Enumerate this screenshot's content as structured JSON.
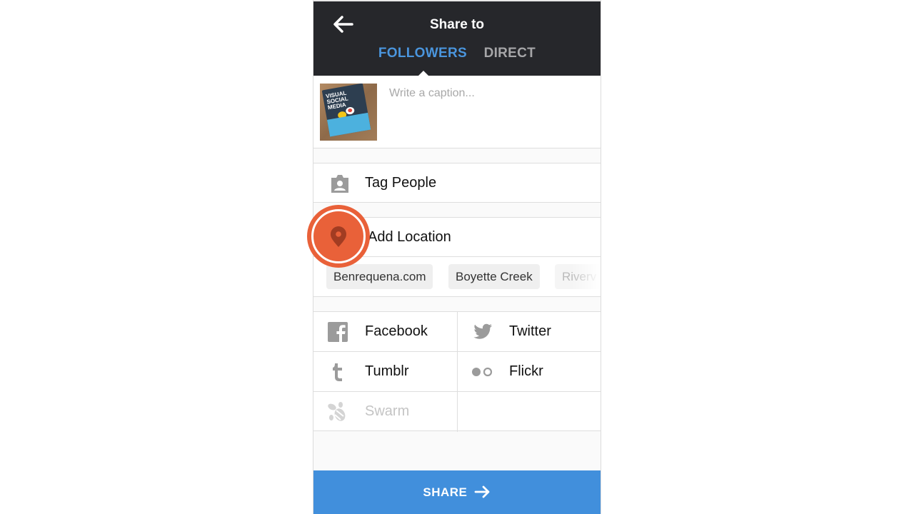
{
  "header": {
    "title": "Share to",
    "back_icon": "arrow-left-icon",
    "tabs": [
      {
        "label": "FOLLOWERS",
        "active": true
      },
      {
        "label": "DIRECT",
        "active": false
      }
    ]
  },
  "caption": {
    "placeholder": "Write a caption...",
    "value": "",
    "thumbnail_text": "VISUAL SOCIAL MEDIA"
  },
  "options": {
    "tag_people": {
      "label": "Tag People",
      "icon": "tag-person-icon"
    },
    "add_location": {
      "label": "Add Location",
      "icon": "location-pin-icon"
    }
  },
  "location_suggestions": [
    {
      "label": "Benrequena.com"
    },
    {
      "label": "Boyette Creek"
    },
    {
      "label": "Riverv"
    }
  ],
  "social": [
    {
      "label": "Facebook",
      "icon": "facebook-icon",
      "enabled": true
    },
    {
      "label": "Twitter",
      "icon": "twitter-icon",
      "enabled": true
    },
    {
      "label": "Tumblr",
      "icon": "tumblr-icon",
      "enabled": true
    },
    {
      "label": "Flickr",
      "icon": "flickr-icon",
      "enabled": true
    },
    {
      "label": "Swarm",
      "icon": "swarm-icon",
      "enabled": false
    }
  ],
  "share_button": {
    "label": "SHARE",
    "icon": "arrow-right-icon"
  },
  "colors": {
    "header_bg": "#26272b",
    "active_tab": "#4a95dd",
    "share_button": "#418fdc",
    "tap_indicator": "#e96139"
  }
}
